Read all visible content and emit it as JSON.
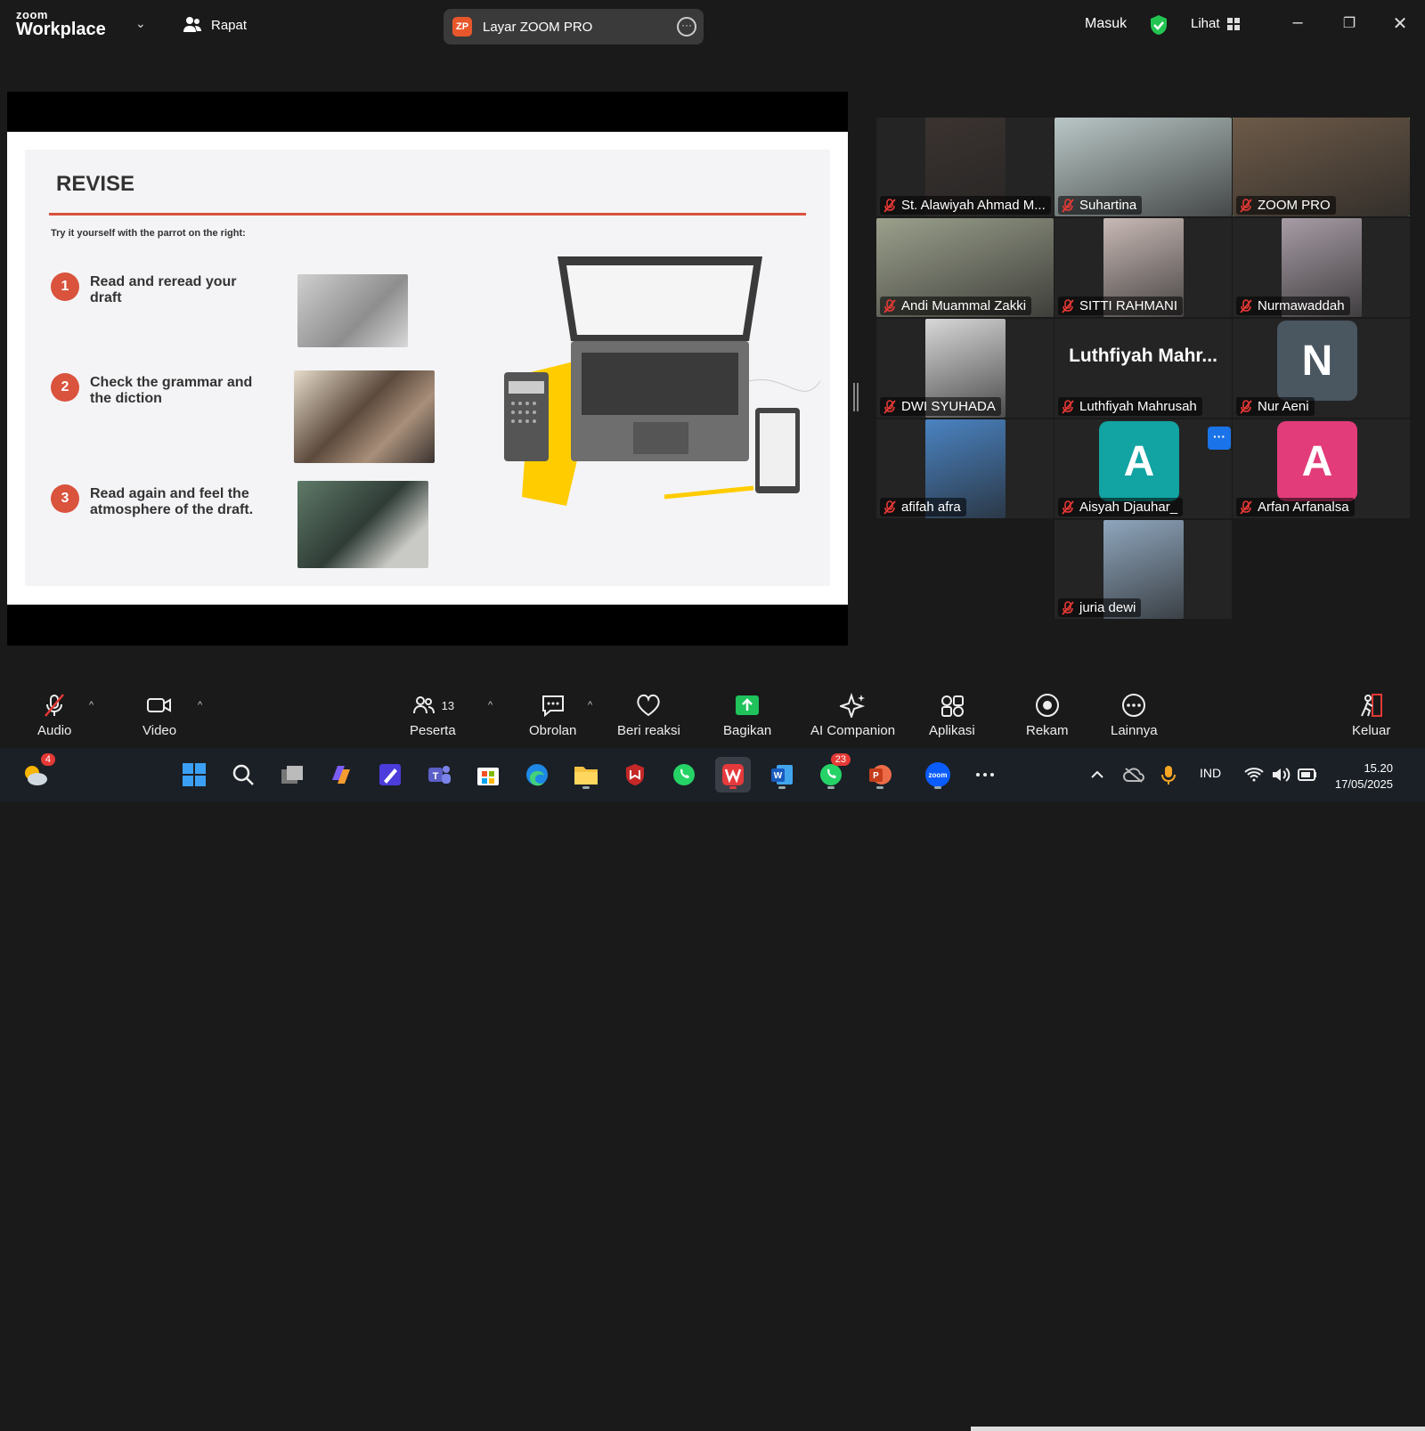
{
  "app": {
    "brand_small": "zoom",
    "brand_big": "Workplace"
  },
  "header": {
    "meeting_label": "Rapat",
    "view_title": "Layar ZOOM PRO",
    "host_initials": "ZP",
    "sign_in": "Masuk",
    "view_label": "Lihat"
  },
  "slide": {
    "title": "REVISE",
    "subtitle": "Try it yourself with the parrot on the right:",
    "steps": [
      {
        "num": "1",
        "text": "Read and reread your draft"
      },
      {
        "num": "2",
        "text": "Check the grammar and the diction"
      },
      {
        "num": "3",
        "text": "Read again and feel the atmosphere of the draft."
      }
    ]
  },
  "participants": [
    {
      "name": "St. Alawiyah Ahmad M...",
      "type": "video",
      "color": "#3b3330"
    },
    {
      "name": "Suhartina",
      "type": "video",
      "color": "#b9c7c6"
    },
    {
      "name": "ZOOM PRO",
      "type": "video",
      "color": "#6d5a48",
      "active": true
    },
    {
      "name": "Andi Muammal Zakki",
      "type": "video",
      "color": "#9ba08c"
    },
    {
      "name": "SITTI RAHMANI",
      "type": "video",
      "color": "#c8b9b5"
    },
    {
      "name": "Nurmawaddah",
      "type": "video",
      "color": "#a79ca5"
    },
    {
      "name": "DWI SYUHADA",
      "type": "video",
      "color": "#d8d8d8"
    },
    {
      "name": "Luthfiyah Mahrusah",
      "type": "name",
      "display": "Luthfiyah  Mahr..."
    },
    {
      "name": "Nur Aeni",
      "type": "avatar",
      "letter": "N",
      "color": "#4a5660"
    },
    {
      "name": "afifah afra",
      "type": "video",
      "color": "#4a83c2"
    },
    {
      "name": "Aisyah Djauhar_",
      "type": "avatar",
      "letter": "A",
      "color": "#12a3a3"
    },
    {
      "name": "Arfan Arfanalsa",
      "type": "avatar",
      "letter": "A",
      "color": "#e33c7a"
    },
    {
      "name": "juria dewi",
      "type": "video",
      "color": "#8fa6bd"
    }
  ],
  "toolbar": {
    "audio": "Audio",
    "video": "Video",
    "participants": "Peserta",
    "participants_count": "13",
    "chat": "Obrolan",
    "react": "Beri reaksi",
    "share": "Bagikan",
    "ai": "AI Companion",
    "apps": "Aplikasi",
    "record": "Rekam",
    "more": "Lainnya",
    "leave": "Keluar"
  },
  "taskbar": {
    "weather_badge": "4",
    "whatsapp_badge": "23",
    "language": "IND",
    "time": "15.20",
    "date": "17/05/2025"
  }
}
